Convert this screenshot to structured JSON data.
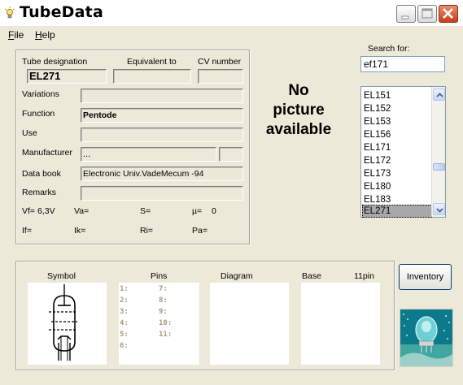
{
  "window": {
    "title": "TubeData"
  },
  "menu": {
    "file_accel": "F",
    "file_rest": "ile",
    "help_accel": "H",
    "help_rest": "elp"
  },
  "info": {
    "tube_designation_label": "Tube designation",
    "equivalent_label": "Equivalent to",
    "cv_label": "CV number",
    "tube_designation_value": "EL271",
    "equivalent_value": "",
    "cv_value": "",
    "variations_label": "Variations",
    "variations_value": "",
    "function_label": "Function",
    "function_value": "Pentode",
    "use_label": "Use",
    "use_value": "",
    "manufacturer_label": "Manufacturer",
    "manufacturer_value": "...",
    "manufacturer_extra": "",
    "databook_label": "Data book",
    "databook_value": "Electronic Univ.VadeMecum -94",
    "remarks_label": "Remarks",
    "remarks_value": "",
    "params": {
      "vf": "Vf= 6,3V",
      "va": "Va=",
      "s": "S=",
      "mu": "µ=",
      "mu_value": "0",
      "if": "If=",
      "ik": "Ik=",
      "ri": "Ri=",
      "pa": "Pa="
    }
  },
  "picture": {
    "line1": "No",
    "line2": "picture",
    "line3": "available"
  },
  "search": {
    "label": "Search for:",
    "value": "ef171"
  },
  "tube_list": {
    "items": [
      "EL151",
      "EL152",
      "EL153",
      "EL156",
      "EL171",
      "EL172",
      "EL173",
      "EL180",
      "EL183",
      "EL271"
    ],
    "selected": "EL271"
  },
  "bottom": {
    "symbol_label": "Symbol",
    "pins_label": "Pins",
    "diagram_label": "Diagram",
    "base_label": "Base",
    "base_value": "11pin",
    "pins_left": [
      "1:",
      "2:",
      "3:",
      "4:",
      "5:",
      "6:"
    ],
    "pins_right": [
      "7:",
      "8:",
      "9:",
      "10:",
      "11:"
    ]
  },
  "inventory_button": "Inventory",
  "icons": {
    "app": "lightbulb-icon",
    "minimize": "minimize-icon",
    "maximize": "maximize-icon",
    "close": "close-icon",
    "scroll_up": "arrow-up-icon",
    "scroll_down": "arrow-down-icon"
  },
  "colors": {
    "close_button": "#c4401c",
    "list_selection": "#a8a8a8",
    "pin_text": "#a59c82",
    "logo_bg": "#0c7a8a"
  }
}
